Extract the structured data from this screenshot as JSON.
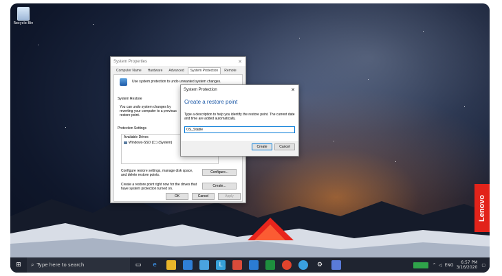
{
  "desktop": {
    "recycle_bin_label": "Recycle Bin"
  },
  "system_properties": {
    "title": "System Properties",
    "tabs": [
      "Computer Name",
      "Hardware",
      "Advanced",
      "System Protection",
      "Remote"
    ],
    "intro": "Use system protection to undo unwanted system changes.",
    "restore_heading": "System Restore",
    "restore_text": "You can undo system changes by reverting your computer to a previous restore point.",
    "protection_heading": "Protection Settings",
    "available_drives_label": "Available Drives",
    "drive_item": "Windows-SSD (C:) (System)",
    "configure_text": "Configure restore settings, manage disk space, and delete restore points.",
    "configure_button": "Configure...",
    "create_text": "Create a restore point right now for the drives that have system protection turned on.",
    "create_button": "Create...",
    "ok_button": "OK",
    "cancel_button": "Cancel",
    "apply_button": "Apply"
  },
  "dialog": {
    "title": "System Protection",
    "heading": "Create a restore point",
    "description": "Type a description to help you identify the restore point. The current date and time are added automatically.",
    "input_value": "OS_Stable",
    "create_button": "Create",
    "cancel_button": "Cancel"
  },
  "taskbar": {
    "search_placeholder": "Type here to search",
    "time": "6:57 PM",
    "date": "3/16/2020",
    "language": "ENG"
  },
  "brand": {
    "label": "Lenovo"
  },
  "colors": {
    "accent": "#0078d7",
    "heading_blue": "#1e5aa8",
    "brand_red": "#e2231a",
    "campfire": "#e8251c"
  }
}
